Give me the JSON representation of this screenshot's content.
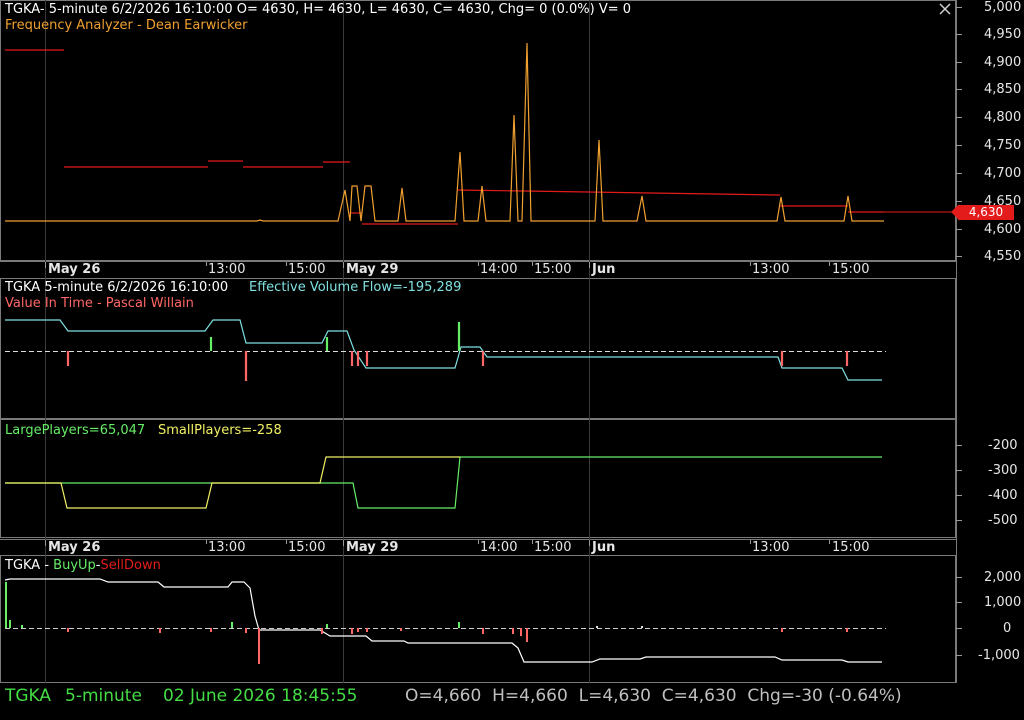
{
  "colors": {
    "background": "#000000",
    "grid": "#3a3a3a",
    "panel_border": "#7a7a7a",
    "orange": "#f0a030",
    "red": "#e41b1b",
    "cyan": "#7fe0e0",
    "green": "#66ee66",
    "yellow": "#f0f066",
    "salmon": "#ff6666"
  },
  "panel1": {
    "title": "TGKA- 5-minute 6/2/2026 16:10:00 O= 4630, H= 4630, L= 4630, C= 4630, Chg= 0 (0.0%) V= 0",
    "subtitle": "Frequency Analyzer - Dean Earwicker",
    "y_ticks": [
      "5,000",
      "4,950",
      "4,900",
      "4,850",
      "4,800",
      "4,750",
      "4,700",
      "4,650",
      "4,600",
      "4,550"
    ],
    "price_tag": "4,630"
  },
  "date_axis": [
    "May 26",
    "13:00",
    "15:00",
    "May 29",
    "14:00",
    "15:00",
    "Jun",
    "13:00",
    "15:00"
  ],
  "panel2": {
    "title": "TGKA 5-minute  6/2/2026 16:10:00",
    "evf": "Effective Volume Flow=-195,289",
    "subtitle": "Value In Time - Pascal Willain"
  },
  "panel3": {
    "large": "LargePlayers=65,047",
    "small": "SmallPlayers=-258",
    "y_ticks": [
      "-200",
      "-300",
      "-400",
      "-500"
    ]
  },
  "panel4": {
    "title_prefix": "TGKA - ",
    "buy": "BuyUp",
    "dash": "-",
    "sell": "SellDown",
    "y_ticks": [
      "2,000",
      "1,000",
      "0",
      "-1,000"
    ]
  },
  "status": {
    "symbol": "TGKA",
    "interval": "5-minute",
    "datetime": "02 June 2026 18:45:55",
    "ohlc": "O=4,660  H=4,660  L=4,630  C=4,630  Chg=-30 (-0.64%)"
  },
  "chart_data": [
    {
      "type": "line",
      "title": "Frequency Analyzer - Dean Earwicker",
      "ylim": [
        4550,
        5000
      ],
      "series": [
        {
          "values": [
            4610,
            4610,
            4610,
            4612,
            4610,
            4610,
            4675,
            4620,
            4675,
            4610,
            4675,
            4610,
            4740,
            4610,
            4675,
            4610,
            4800,
            4610,
            4930,
            4610,
            4610,
            4760,
            4610,
            4660,
            4610,
            4610,
            4660,
            4610,
            4655,
            4610
          ]
        },
        {
          "values": [
            4920,
            4710,
            4710,
            4720,
            4710,
            4720,
            4610,
            4610,
            4665,
            4665,
            4660,
            4660,
            4640,
            4640,
            4630
          ]
        }
      ]
    },
    {
      "type": "line",
      "title": "Effective Volume Flow=-195,289"
    },
    {
      "type": "line",
      "ylim": [
        -550,
        -150
      ],
      "series": [
        {
          "name": "LargePlayers",
          "values": [
            -350,
            -350,
            -350,
            -350,
            -250,
            -250,
            -250,
            -250,
            -250,
            -250
          ]
        },
        {
          "name": "SmallPlayers",
          "values": [
            -350,
            -450,
            -450,
            -350,
            -350,
            -450,
            -450,
            -250,
            -250,
            -250
          ]
        }
      ]
    },
    {
      "type": "line",
      "title": "TGKA - BuyUp-SellDown",
      "ylim": [
        -1500,
        2500
      ],
      "series": [
        {
          "values": [
            1900,
            1900,
            1600,
            1650,
            -50,
            -50,
            -150,
            -250,
            -300,
            -1300,
            -1200,
            -1100,
            -1100,
            -1200,
            -1300
          ]
        }
      ]
    }
  ]
}
